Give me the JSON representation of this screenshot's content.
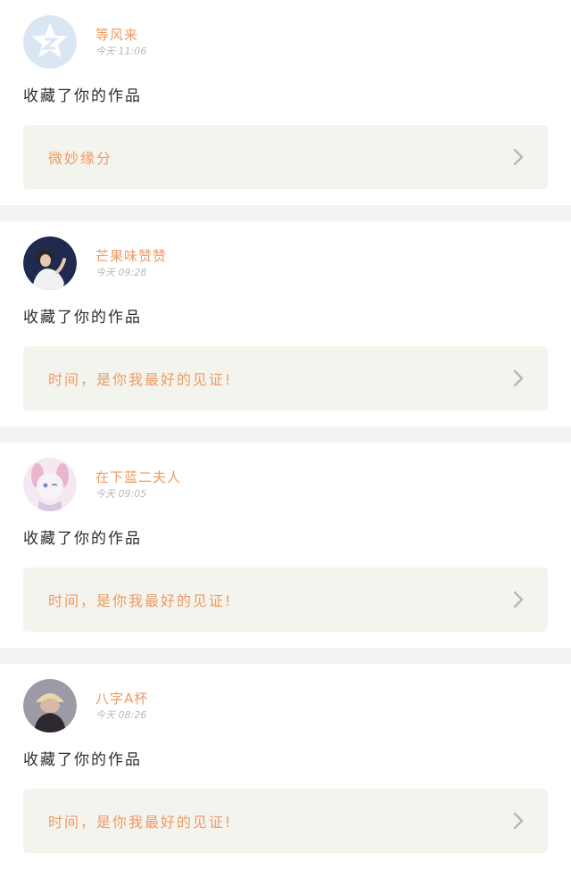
{
  "feed": [
    {
      "username": "等风来",
      "time": "今天 11:06",
      "action": "收藏了你的作品",
      "work_title": "微妙缘分",
      "avatar_icon": "default-qq-avatar-icon",
      "avatar_colors": [
        "#dbe6f3",
        "#ffffff"
      ]
    },
    {
      "username": "芒果味赞赞",
      "time": "今天 09:28",
      "action": "收藏了你的作品",
      "work_title": "时间，是你我最好的见证!",
      "avatar_icon": "person-photo-avatar-icon",
      "avatar_colors": [
        "#1f2a4e",
        "#f1f1f1"
      ]
    },
    {
      "username": "在下蓝二夫人",
      "time": "今天 09:05",
      "action": "收藏了你的作品",
      "work_title": "时间，是你我最好的见证!",
      "avatar_icon": "anime-girl-avatar-icon",
      "avatar_colors": [
        "#f4e9f2",
        "#e9b6cf"
      ]
    },
    {
      "username": "八字A杯",
      "time": "今天 08:26",
      "action": "收藏了你的作品",
      "work_title": "时间，是你我最好的见证!",
      "avatar_icon": "person-hat-avatar-icon",
      "avatar_colors": [
        "#9c9aa4",
        "#e9d9a8"
      ]
    }
  ],
  "chevron_icon": "chevron-right-icon",
  "colors": {
    "accent": "#ef9a62",
    "background": "#f3f3f3",
    "link_card": "#f4f4ee",
    "chevron": "#b7b7b7"
  }
}
